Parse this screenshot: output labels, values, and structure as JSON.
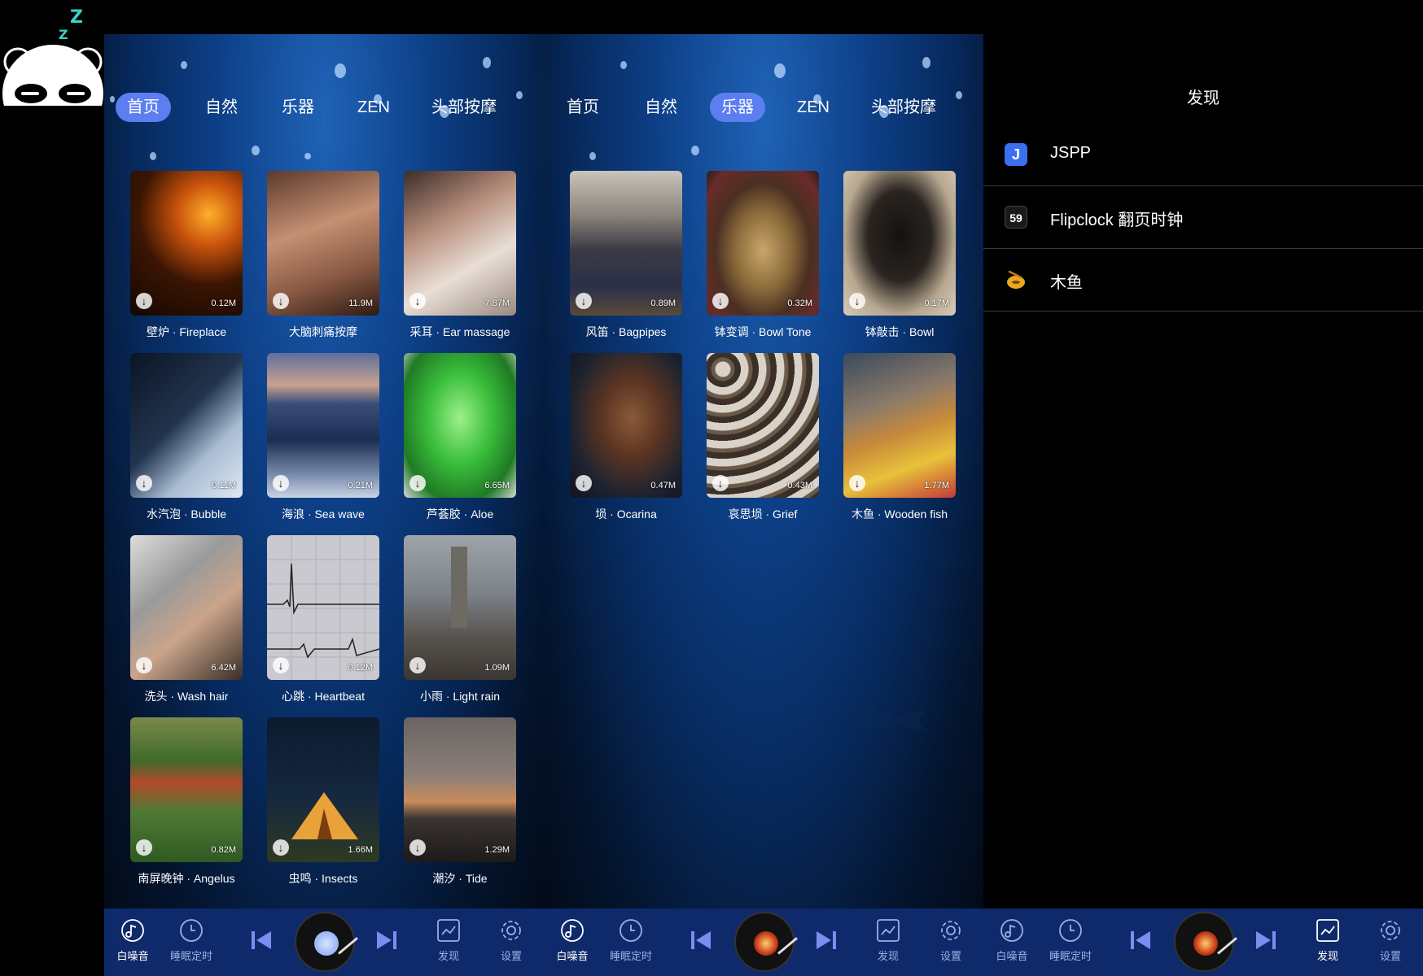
{
  "colors": {
    "accent": "#5c7ef1",
    "bottom_bar": "#0f2a6b",
    "logo_z": "#38d0c8"
  },
  "panel1": {
    "tabs": [
      {
        "label": "首页",
        "active": true
      },
      {
        "label": "自然",
        "active": false
      },
      {
        "label": "乐器",
        "active": false
      },
      {
        "label": "ZEN",
        "active": false
      },
      {
        "label": "头部按摩",
        "active": false
      }
    ],
    "cards": [
      {
        "label": "壁炉 · Fireplace",
        "size": "0.12M"
      },
      {
        "label": "大脑刺痛按摩",
        "size": "11.9M"
      },
      {
        "label": "采耳 · Ear massage",
        "size": "7.87M"
      },
      {
        "label": "水汽泡 · Bubble",
        "size": "0.11M"
      },
      {
        "label": "海浪 · Sea wave",
        "size": "0.21M"
      },
      {
        "label": "芦荟胶 · Aloe",
        "size": "6.65M"
      },
      {
        "label": "洗头 · Wash hair",
        "size": "6.42M"
      },
      {
        "label": "心跳 · Heartbeat",
        "size": "0.12M"
      },
      {
        "label": "小雨 · Light rain",
        "size": "1.09M"
      },
      {
        "label": "南屏晚钟 · Angelus",
        "size": "0.82M"
      },
      {
        "label": "虫鸣 · Insects",
        "size": "1.66M"
      },
      {
        "label": "潮汐 · Tide",
        "size": "1.29M"
      }
    ]
  },
  "panel2": {
    "tabs": [
      {
        "label": "首页",
        "active": false
      },
      {
        "label": "自然",
        "active": false
      },
      {
        "label": "乐器",
        "active": true
      },
      {
        "label": "ZEN",
        "active": false
      },
      {
        "label": "头部按摩",
        "active": false
      }
    ],
    "cards": [
      {
        "label": "风笛 · Bagpipes",
        "size": "0.89M"
      },
      {
        "label": "钵变调 · Bowl Tone",
        "size": "0.32M"
      },
      {
        "label": "钵敲击 · Bowl",
        "size": "0.17M"
      },
      {
        "label": "埙 · Ocarina",
        "size": "0.47M"
      },
      {
        "label": "哀思埙 · Grief",
        "size": "0.43M"
      },
      {
        "label": "木鱼 · Wooden fish",
        "size": "1.77M"
      }
    ]
  },
  "discover": {
    "title": "发现",
    "items": [
      {
        "label": "JSPP",
        "icon": "j-app-icon",
        "icon_text": "J"
      },
      {
        "label": "Flipclock 翻页时钟",
        "icon": "flipclock-icon",
        "icon_text": "59"
      },
      {
        "label": "木鱼",
        "icon": "wooden-fish-icon",
        "icon_text": ""
      }
    ]
  },
  "bottom_nav": {
    "white_noise": "白噪音",
    "sleep_timer": "睡眠定时",
    "discover": "发现",
    "settings": "设置"
  }
}
